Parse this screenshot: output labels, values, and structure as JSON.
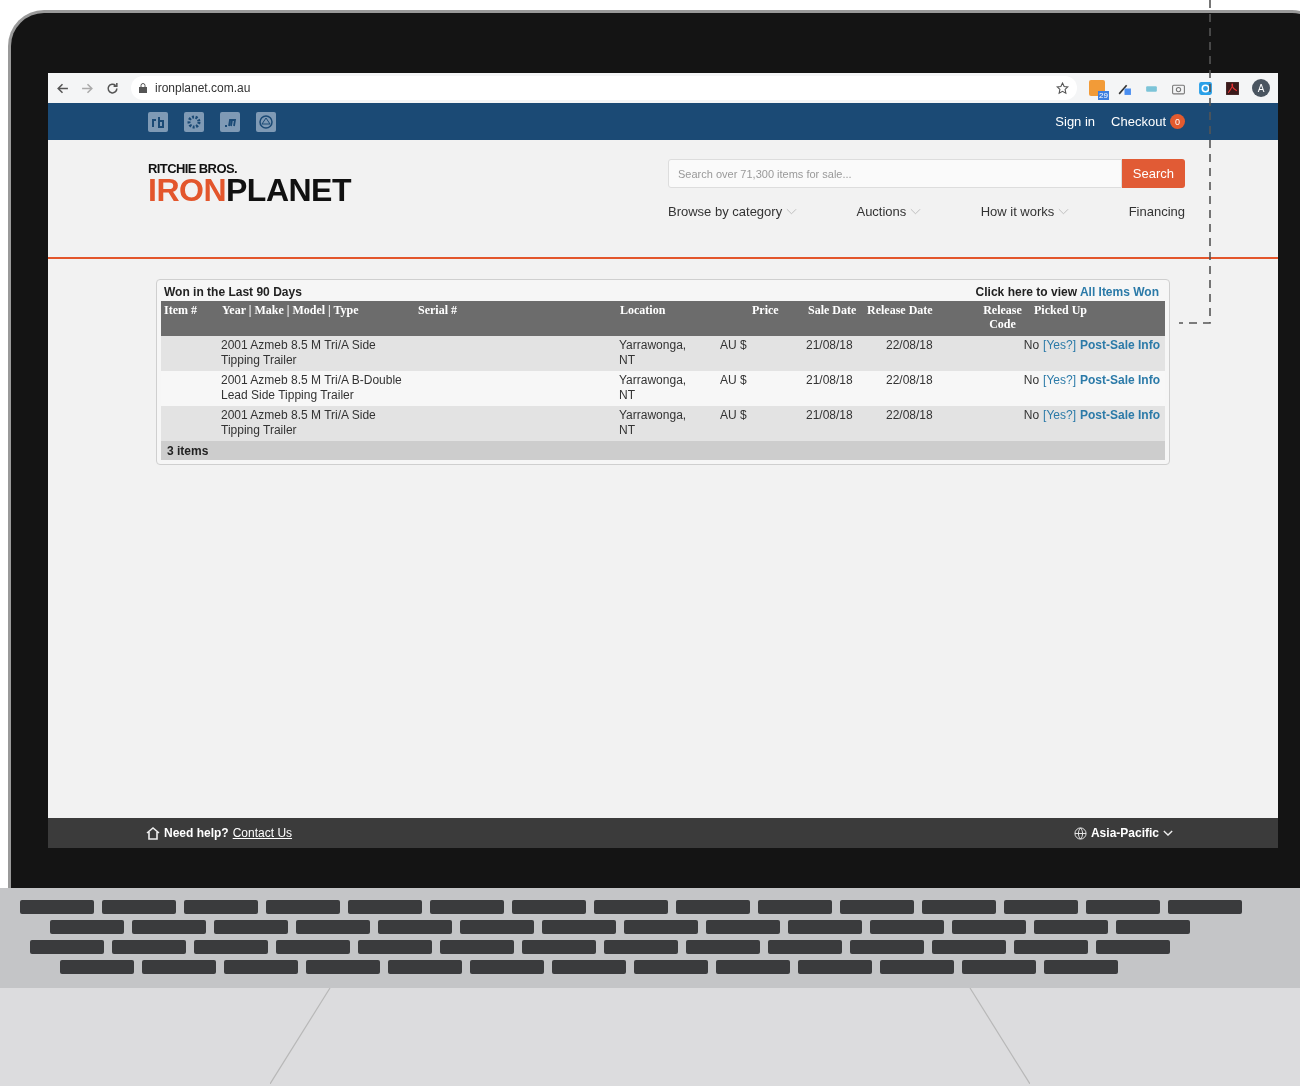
{
  "browser": {
    "url": "ironplanet.com.au",
    "extension_badge": "29",
    "avatar": "A"
  },
  "topbar": {
    "sign_in": "Sign in",
    "checkout": "Checkout",
    "cart_count": "0"
  },
  "header": {
    "logo": {
      "top": "RITCHIE BROS.",
      "first": "IRON",
      "second": "PLANET"
    },
    "search": {
      "placeholder": "Search over 71,300 items for sale...",
      "button": "Search"
    },
    "nav": [
      {
        "label": "Browse by category",
        "dropdown": true
      },
      {
        "label": "Auctions",
        "dropdown": true
      },
      {
        "label": "How it works",
        "dropdown": true
      },
      {
        "label": "Financing",
        "dropdown": false
      }
    ]
  },
  "table": {
    "title": "Won in the Last 90 Days",
    "view_prefix": "Click here to view",
    "view_link": "All Items Won",
    "columns": [
      "Item #",
      "Year | Make | Model | Type",
      "Serial #",
      "Location",
      "Price",
      "Sale Date",
      "Release Date",
      "Release Code",
      "Picked Up"
    ],
    "rows": [
      {
        "description": "2001 Azmeb 8.5 M Tri/A Side Tipping Trailer",
        "location": "Yarrawonga, NT",
        "price": "AU $",
        "sale_date": "21/08/18",
        "release_date": "22/08/18",
        "picked_up": "No",
        "confirm_link": "[Yes?]",
        "info_link": "Post-Sale Info"
      },
      {
        "description": "2001 Azmeb 8.5 M Tri/A B-Double Lead Side Tipping Trailer",
        "location": "Yarrawonga, NT",
        "price": "AU $",
        "sale_date": "21/08/18",
        "release_date": "22/08/18",
        "picked_up": "No",
        "confirm_link": "[Yes?]",
        "info_link": "Post-Sale Info"
      },
      {
        "description": "2001 Azmeb 8.5 M Tri/A Side Tipping Trailer",
        "location": "Yarrawonga, NT",
        "price": "AU $",
        "sale_date": "21/08/18",
        "release_date": "22/08/18",
        "picked_up": "No",
        "confirm_link": "[Yes?]",
        "info_link": "Post-Sale Info"
      }
    ],
    "footer": "3 items"
  },
  "footer": {
    "help": "Need help?",
    "contact": "Contact Us",
    "region": "Asia-Pacific"
  }
}
